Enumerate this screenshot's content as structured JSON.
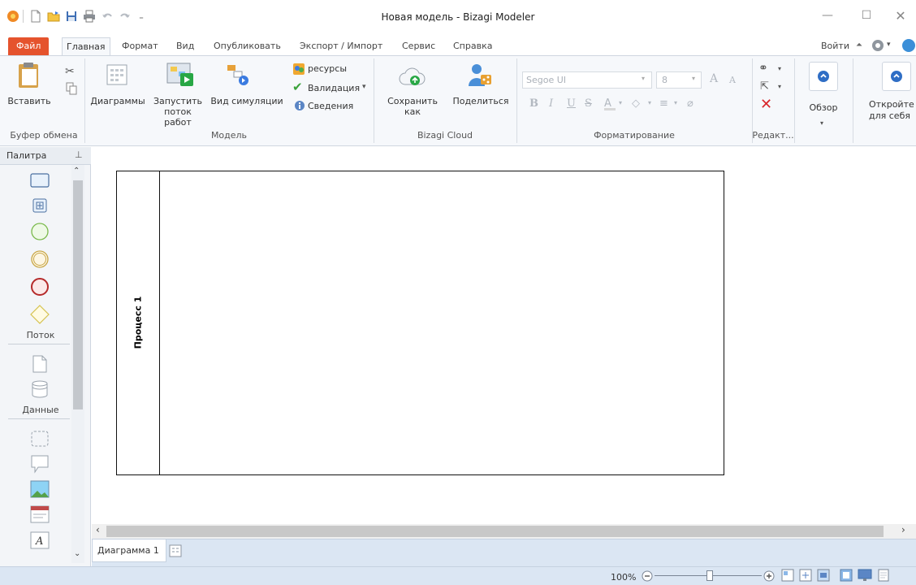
{
  "window": {
    "title": "Новая модель - Bizagi Modeler"
  },
  "titlebar_icons": [
    "app-logo-icon",
    "new-file-icon",
    "open-folder-icon",
    "save-icon",
    "print-icon",
    "undo-icon",
    "redo-icon",
    "customize-icon"
  ],
  "window_controls": [
    "minimize-icon",
    "maximize-icon",
    "close-icon"
  ],
  "menu": {
    "tabs": [
      "Файл",
      "Главная",
      "Формат",
      "Вид",
      "Опубликовать",
      "Экспорт / Импорт",
      "Сервис",
      "Справка"
    ],
    "active": "Главная",
    "login": "Войти"
  },
  "ribbon": {
    "clipboard": {
      "paste": "Вставить",
      "group": "Буфер обмена"
    },
    "model": {
      "diagrams": "Диаграммы",
      "run_workflow_1": "Запустить",
      "run_workflow_2": "поток работ",
      "simulation": "Вид симуляции",
      "resources": "ресурсы",
      "validation": "Валидация",
      "info": "Сведения",
      "group": "Модель"
    },
    "cloud": {
      "save_as": "Сохранить как",
      "share": "Поделиться",
      "group": "Bizagi Cloud"
    },
    "formatting": {
      "font": "Segoe UI",
      "size": "8",
      "group": "Форматирование"
    },
    "edit": {
      "group": "Редакт..."
    },
    "overview": {
      "label": "Обзор"
    },
    "open_for_self": {
      "line1": "Откройте",
      "line2": "для себя"
    }
  },
  "palette": {
    "title": "Палитра",
    "section_flow": "Поток",
    "section_data": "Данные"
  },
  "canvas": {
    "pool_title": "Процесс 1"
  },
  "tabs": {
    "diagram": "Диаграмма 1"
  },
  "status": {
    "zoom": "100%"
  },
  "colors": {
    "file_tab": "#e5532d",
    "ribbon_bg": "#f6f8fb",
    "status_bg": "#dbe6f3"
  }
}
